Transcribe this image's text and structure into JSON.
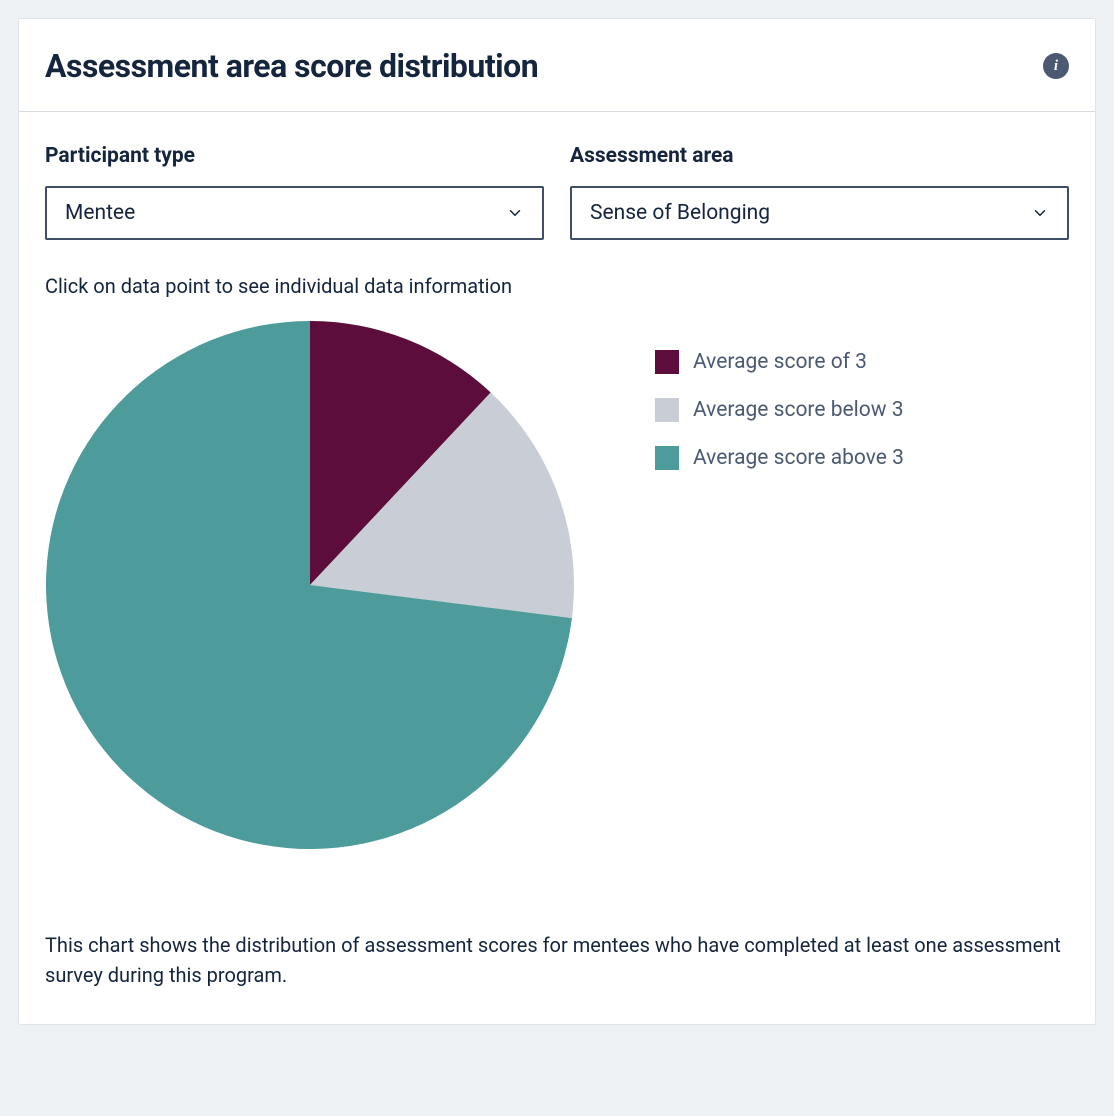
{
  "header": {
    "title": "Assessment area score distribution"
  },
  "filters": {
    "participant_type": {
      "label": "Participant type",
      "value": "Mentee"
    },
    "assessment_area": {
      "label": "Assessment area",
      "value": "Sense of Belonging"
    }
  },
  "hint": "Click on data point to see individual data information",
  "legend": [
    {
      "label": "Average score of 3",
      "color": "#5c0d3c"
    },
    {
      "label": "Average score below 3",
      "color": "#c8cdd6"
    },
    {
      "label": "Average score above 3",
      "color": "#4e9b9b"
    }
  ],
  "footer": "This chart shows the distribution of assessment scores for mentees who have completed at least one assessment survey during this program.",
  "chart_data": {
    "type": "pie",
    "title": "Assessment area score distribution",
    "series": [
      {
        "name": "Average score of 3",
        "value": 12,
        "color": "#5c0d3c"
      },
      {
        "name": "Average score below 3",
        "value": 15,
        "color": "#c8cdd6"
      },
      {
        "name": "Average score above 3",
        "value": 73,
        "color": "#4e9b9b"
      }
    ]
  }
}
